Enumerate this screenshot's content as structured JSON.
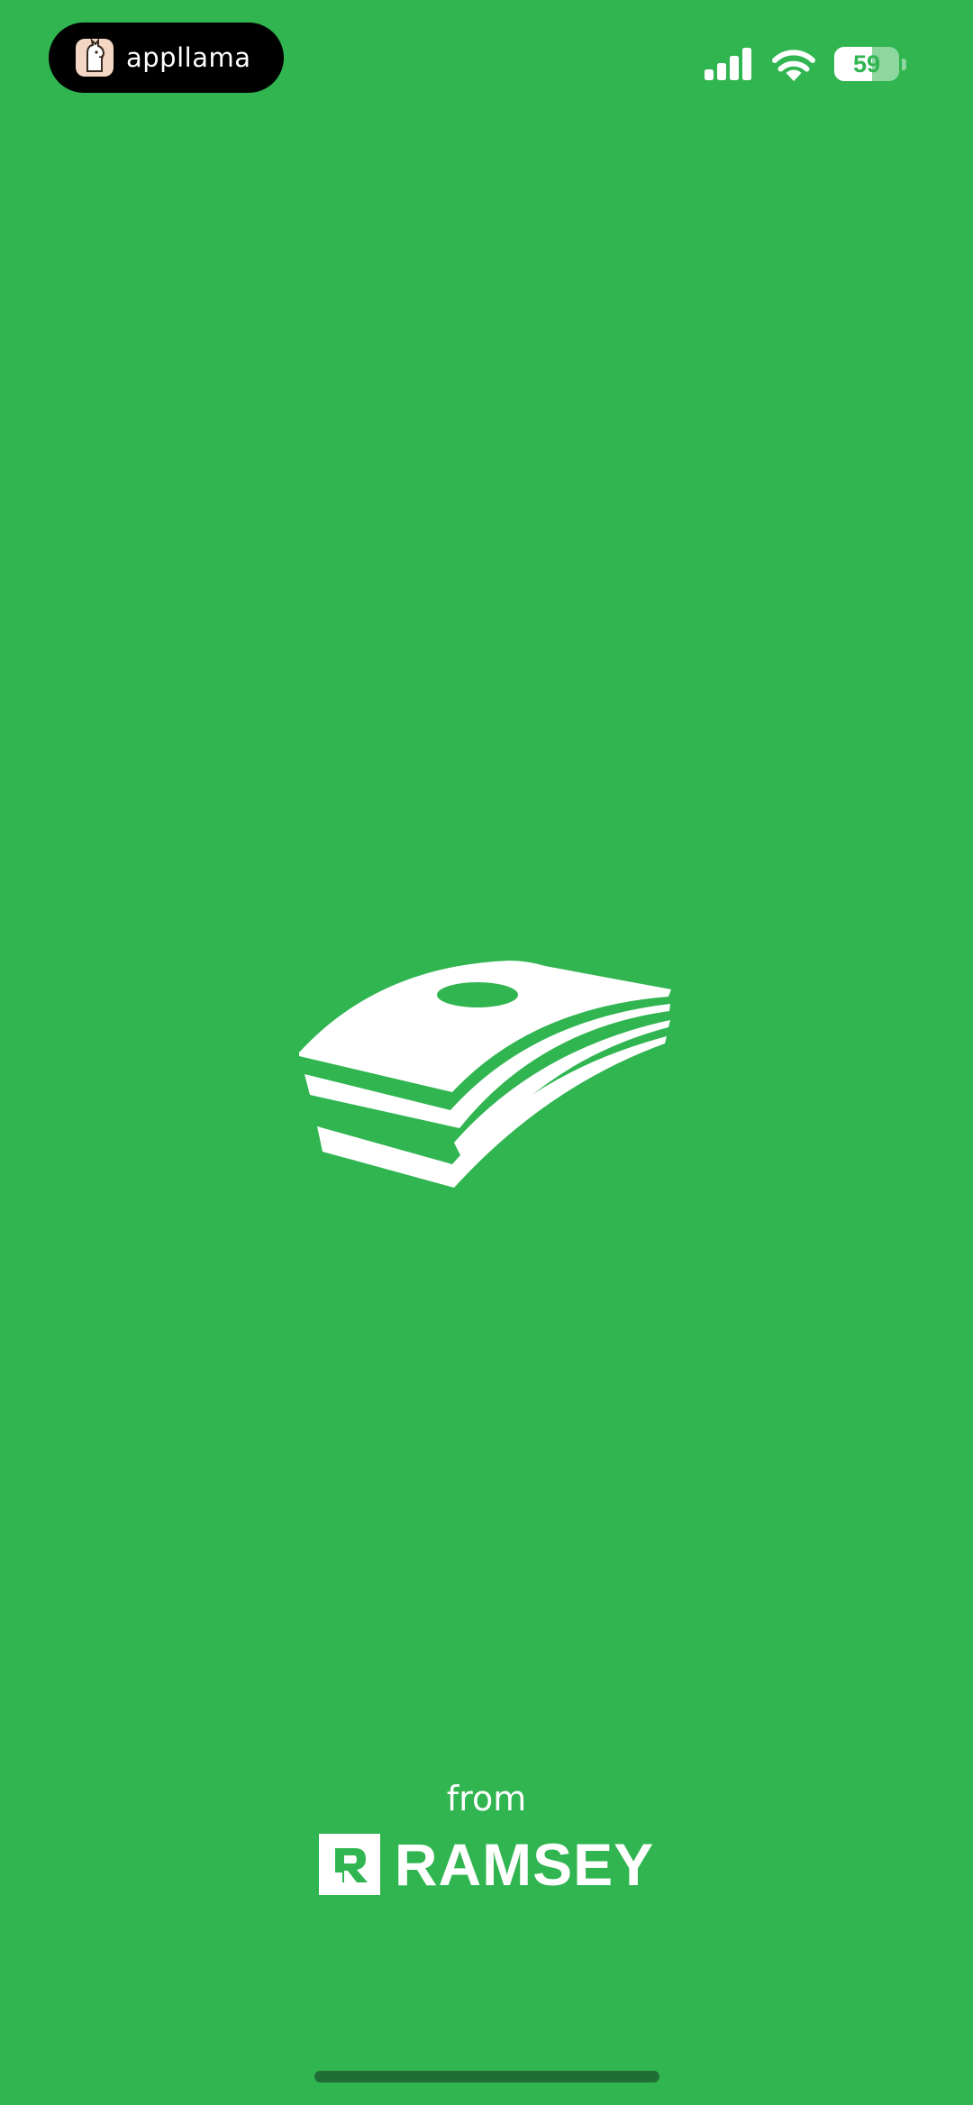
{
  "status_bar": {
    "pill_label": "appllama",
    "battery_level": "59",
    "battery_fraction": 0.59
  },
  "splash": {
    "icon": "money-stack-icon",
    "from_label": "from",
    "brand_name": "RAMSEY",
    "brand_icon": "ramsey-r-logo-icon"
  },
  "colors": {
    "background": "#31B551",
    "foreground": "#FFFFFF",
    "pill": "#000000",
    "home_indicator": "#1E6E35"
  }
}
